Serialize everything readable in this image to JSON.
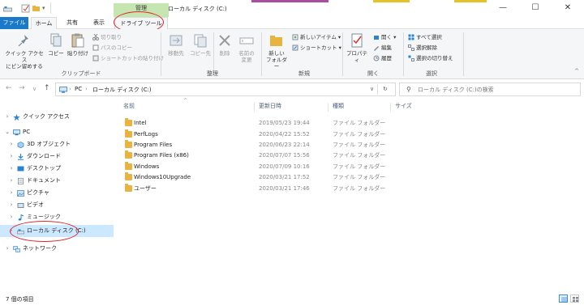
{
  "window": {
    "title": "ローカル ディスク (C:)",
    "contextual_tab_header": "管理",
    "controls": [
      "—",
      "☐",
      "✕"
    ]
  },
  "ribbon_tabs": [
    {
      "label": "ファイル"
    },
    {
      "label": "ホーム"
    },
    {
      "label": "共有"
    },
    {
      "label": "表示"
    },
    {
      "label": "ドライブ ツール"
    }
  ],
  "ribbon": {
    "clipboard": {
      "pin_label": "クイック アクセス\nにピン留めする",
      "copy_label": "コピー",
      "paste_label": "貼り付け",
      "cut_label": "切り取り",
      "copy_path_label": "パスのコピー",
      "paste_shortcut_label": "ショートカットの貼り付け",
      "group_label": "クリップボード"
    },
    "organize": {
      "move_label": "移動先",
      "copyto_label": "コピー先",
      "delete_label": "削除",
      "rename_label": "名前の\n変更",
      "group_label": "整理"
    },
    "new": {
      "new_folder_label": "新しい\nフォルダー",
      "new_item_label": "新しいアイテム",
      "shortcut_label": "ショートカット",
      "group_label": "新規"
    },
    "open": {
      "properties_label": "プロパティ",
      "open_label": "開く",
      "edit_label": "編集",
      "history_label": "履歴",
      "group_label": "開く"
    },
    "select": {
      "select_all_label": "すべて選択",
      "select_none_label": "選択解除",
      "invert_label": "選択の切り替え",
      "group_label": "選択"
    }
  },
  "address": {
    "crumbs": [
      "PC",
      "ローカル ディスク (C:)"
    ],
    "search_placeholder": "ローカル ディスク (C:)の検索"
  },
  "nav": {
    "quick_access": "クイック アクセス",
    "pc": "PC",
    "items": [
      {
        "label": "3D オブジェクト"
      },
      {
        "label": "ダウンロード"
      },
      {
        "label": "デスクトップ"
      },
      {
        "label": "ドキュメント"
      },
      {
        "label": "ピクチャ"
      },
      {
        "label": "ビデオ"
      },
      {
        "label": "ミュージック"
      },
      {
        "label": "ローカル ディスク (C:)"
      }
    ],
    "network": "ネットワーク"
  },
  "columns": [
    "名前",
    "更新日時",
    "種類",
    "サイズ"
  ],
  "files": [
    {
      "name": "Intel",
      "date": "2019/05/23 19:44",
      "type": "ファイル フォルダー"
    },
    {
      "name": "PerfLogs",
      "date": "2020/04/22 15:52",
      "type": "ファイル フォルダー"
    },
    {
      "name": "Program Files",
      "date": "2020/06/23 22:14",
      "type": "ファイル フォルダー"
    },
    {
      "name": "Program Files (x86)",
      "date": "2020/07/07 15:56",
      "type": "ファイル フォルダー"
    },
    {
      "name": "Windows",
      "date": "2020/07/09 10:16",
      "type": "ファイル フォルダー"
    },
    {
      "name": "Windows10Upgrade",
      "date": "2020/03/21 17:52",
      "type": "ファイル フォルダー"
    },
    {
      "name": "ユーザー",
      "date": "2020/03/21 17:46",
      "type": "ファイル フォルダー"
    }
  ],
  "status": {
    "item_count": "7 個の項目"
  },
  "colors": {
    "accent": "#1979ca",
    "manage_tab": "#c5e6b0",
    "selection": "#cce8ff",
    "annotation": "#e0242a",
    "folder": "#e8b33e"
  }
}
